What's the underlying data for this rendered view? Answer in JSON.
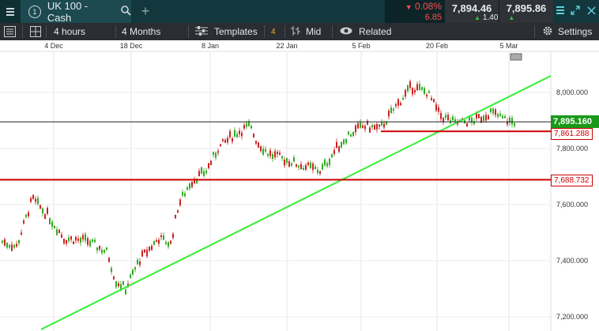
{
  "instrument": {
    "number": "1",
    "name": "UK 100 - Cash",
    "change_pct": "0.08%",
    "change_abs": "6.85",
    "sell": "7,894.46",
    "buy": "7,895.86",
    "spread": "1.40"
  },
  "toolbar": {
    "interval": "4 hours",
    "range": "4 Months",
    "templates": "Templates",
    "templates_badge": "4",
    "price_type": "Mid",
    "related": "Related",
    "settings": "Settings"
  },
  "chart_data": {
    "type": "candlestick",
    "x_ticks": [
      "4 Dec",
      "18 Dec",
      "8 Jan",
      "22 Jan",
      "5 Feb",
      "20 Feb",
      "5 Mar"
    ],
    "y_ticks": [
      "8,000.000",
      "7,800.000",
      "7,600.000",
      "7,400.000",
      "7,200.000"
    ],
    "ylim": [
      7170,
      8080
    ],
    "current_price": "7,895.160",
    "horizontal_lines": [
      {
        "label": "7,861.288",
        "value": 7861.288,
        "color": "#cc0000"
      },
      {
        "label": "7,688.732",
        "value": 7688.732,
        "color": "#cc0000"
      }
    ],
    "trendline": {
      "color": "#33ee33"
    },
    "colors": {
      "up": "#33aa22",
      "down": "#cc2222"
    }
  }
}
